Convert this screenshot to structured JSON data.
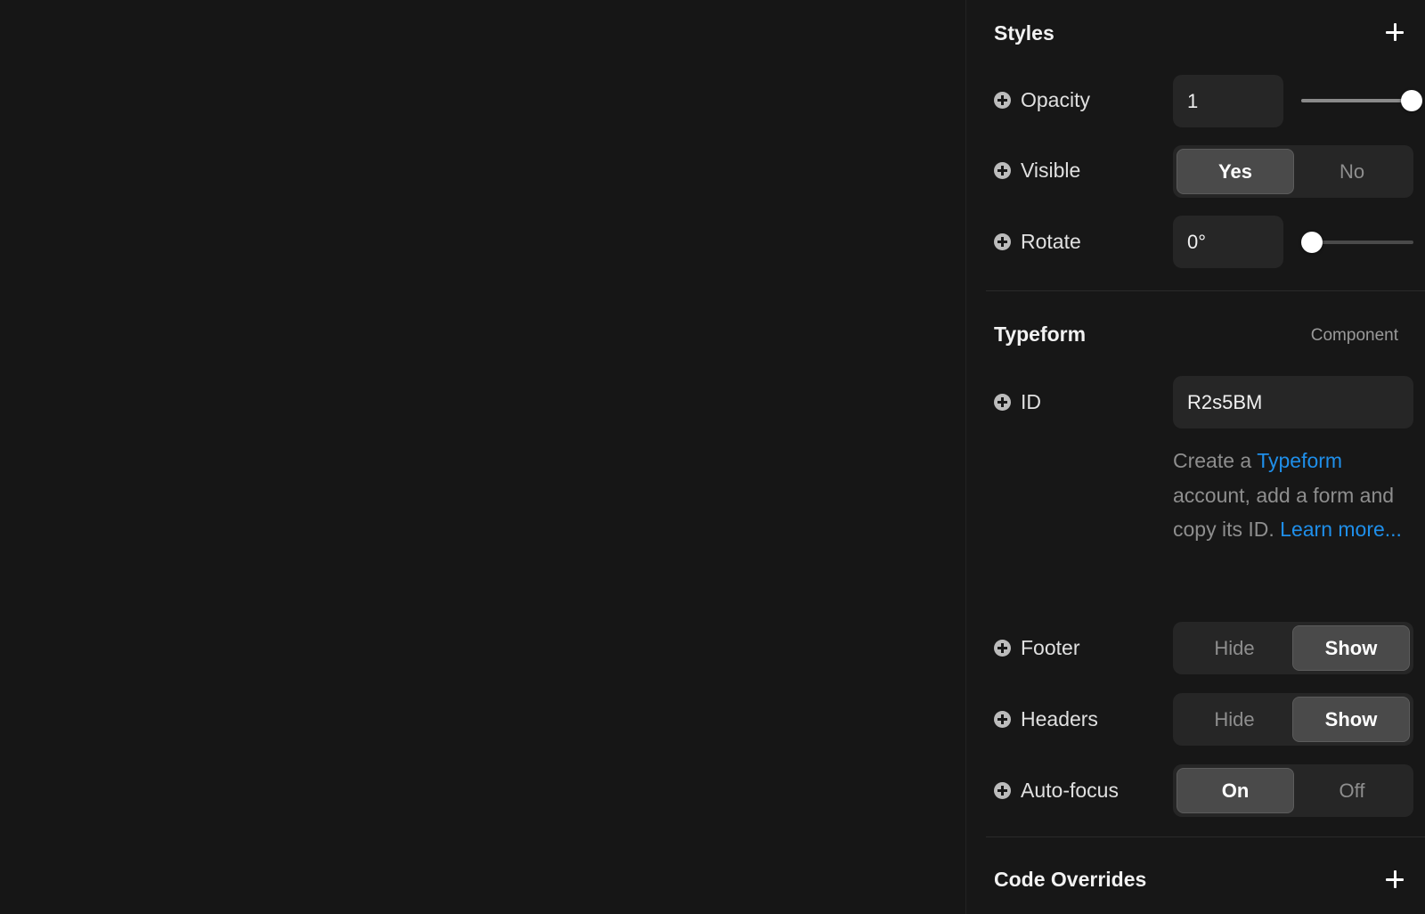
{
  "styles": {
    "title": "Styles",
    "opacity": {
      "label": "Opacity",
      "value": "1",
      "slider_fraction": 1.0
    },
    "visible": {
      "label": "Visible",
      "options": [
        "Yes",
        "No"
      ],
      "selected": "Yes"
    },
    "rotate": {
      "label": "Rotate",
      "value": "0°",
      "slider_fraction": 0.0
    }
  },
  "typeform": {
    "title": "Typeform",
    "tag": "Component",
    "id": {
      "label": "ID",
      "value": "R2s5BM"
    },
    "help": {
      "text1": "Create a ",
      "link1": "Typeform",
      "text2": " account, add a form and copy its ID. ",
      "link2": "Learn more..."
    },
    "footer": {
      "label": "Footer",
      "options": [
        "Hide",
        "Show"
      ],
      "selected": "Show"
    },
    "headers": {
      "label": "Headers",
      "options": [
        "Hide",
        "Show"
      ],
      "selected": "Show"
    },
    "autofocus": {
      "label": "Auto-focus",
      "options": [
        "On",
        "Off"
      ],
      "selected": "On"
    }
  },
  "code_overrides": {
    "title": "Code Overrides"
  },
  "colors": {
    "link": "#1f8fea",
    "background": "#161616",
    "field": "#262626"
  },
  "icons": {
    "add": "plus-circle-icon",
    "section_add": "plus-icon"
  }
}
